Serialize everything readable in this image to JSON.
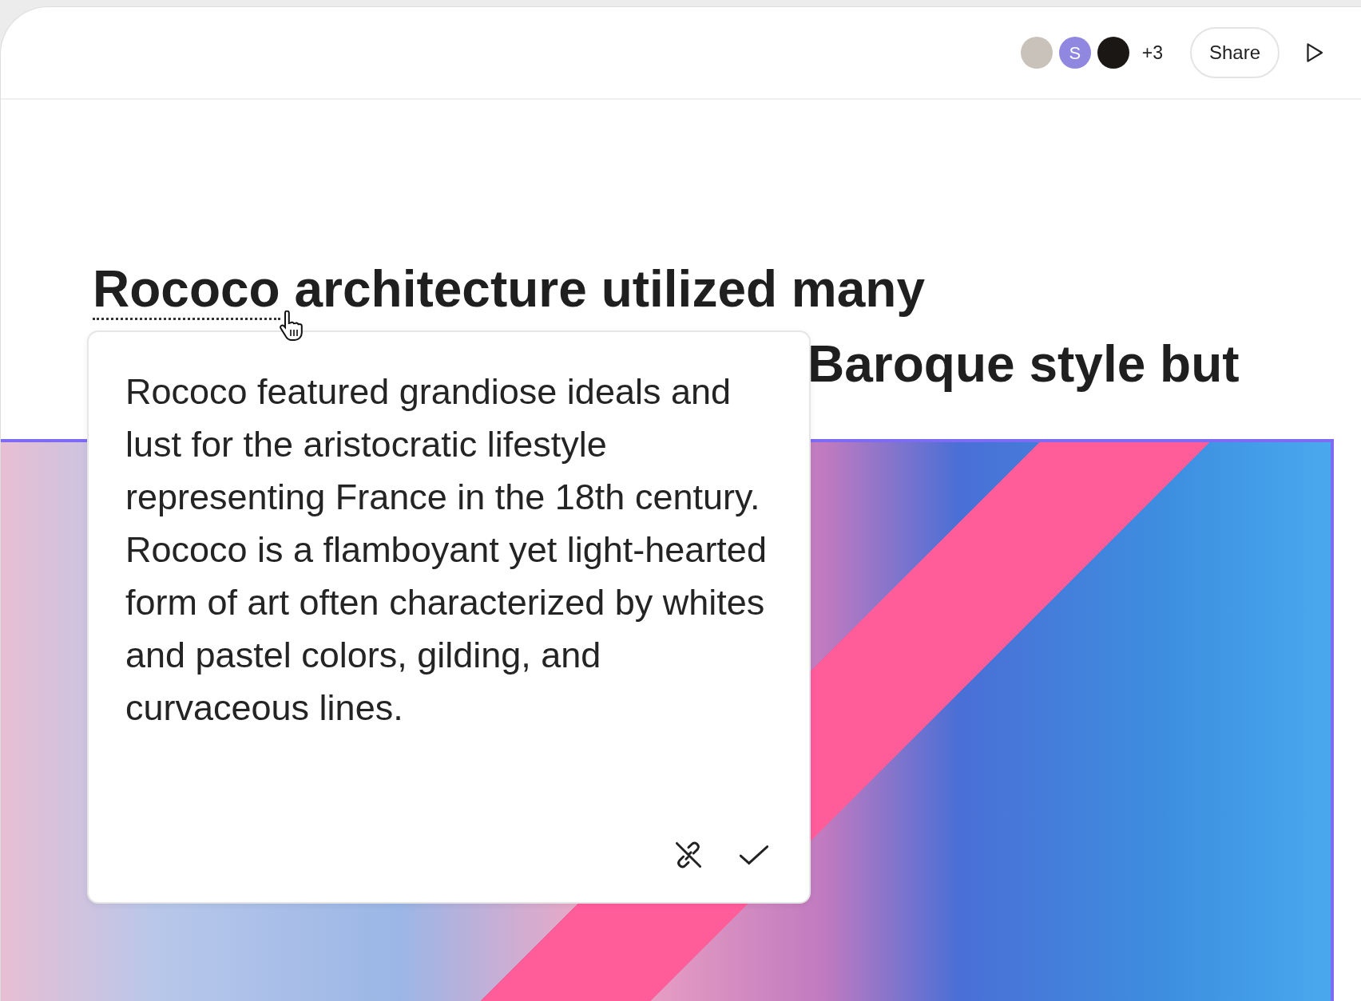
{
  "topbar": {
    "avatars": [
      {
        "kind": "photo",
        "color": "#c9c2bb"
      },
      {
        "kind": "initial",
        "initial": "S",
        "color": "#8f87e0"
      },
      {
        "kind": "photo",
        "color": "#1b1714"
      }
    ],
    "more_count": "+3",
    "share_button": "Share"
  },
  "heading": {
    "link_text": "Rococo",
    "line1_rest": "architecture utilized many",
    "line2_visible": "Baroque style but"
  },
  "popover": {
    "text": "Rococo featured grandiose ideals and lust for the aristocratic lifestyle representing France in the 18th century. Rococo is a flamboyant yet light-hearted form of art often characterized by whites and pastel colors, gilding, and curvaceous lines."
  }
}
